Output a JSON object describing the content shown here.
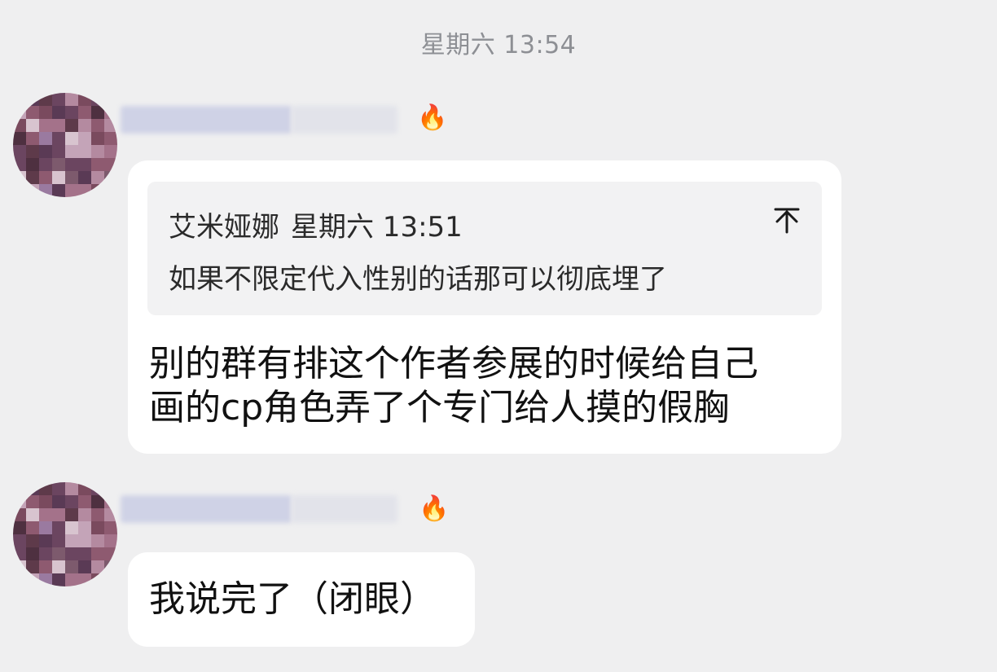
{
  "header": {
    "timestamp": "星期六 13:54"
  },
  "messages": [
    {
      "sender_badge_icon": "campfire-icon",
      "quote": {
        "author": "艾米娅娜",
        "time": "星期六 13:51",
        "text": "如果不限定代入性别的话那可以彻底埋了",
        "jump_icon": "jump-to-top-icon"
      },
      "lines": [
        "别的群有排这个作者参展的时候给自己",
        "画的cp角色弄了个专门给人摸的假胸"
      ]
    },
    {
      "sender_badge_icon": "campfire-icon",
      "lines": [
        "我说完了（闭眼）"
      ]
    }
  ],
  "colors": {
    "background": "#efeff0",
    "bubble": "#ffffff",
    "quote_background": "#f2f2f3",
    "timestamp": "#8d8f94"
  }
}
